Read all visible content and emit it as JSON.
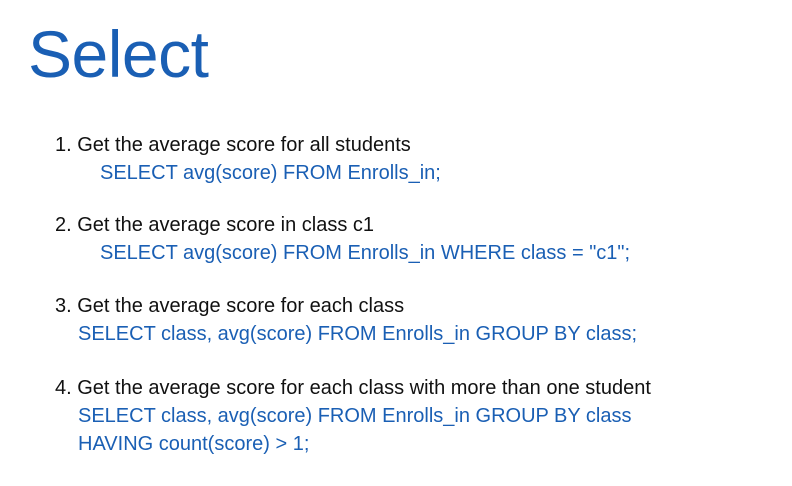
{
  "slide": {
    "title": "Select",
    "items": [
      {
        "question": "1. Get the average score for all students",
        "sql": [
          "SELECT avg(score) FROM  Enrolls_in;"
        ]
      },
      {
        "question": "2. Get the average score in class c1",
        "sql": [
          "SELECT avg(score) FROM  Enrolls_in WHERE class = \"c1\";"
        ]
      },
      {
        "question": "3. Get the average score for each class",
        "sql": [
          "SELECT class, avg(score) FROM Enrolls_in GROUP BY class;"
        ]
      },
      {
        "question": "4. Get the average score for each class with more than one student",
        "sql": [
          "SELECT class, avg(score) FROM Enrolls_in GROUP BY class",
          "HAVING count(score) > 1;"
        ]
      }
    ]
  },
  "colors": {
    "title": "#1a5fb4",
    "sql": "#1a5fb4",
    "question": "#111111"
  }
}
